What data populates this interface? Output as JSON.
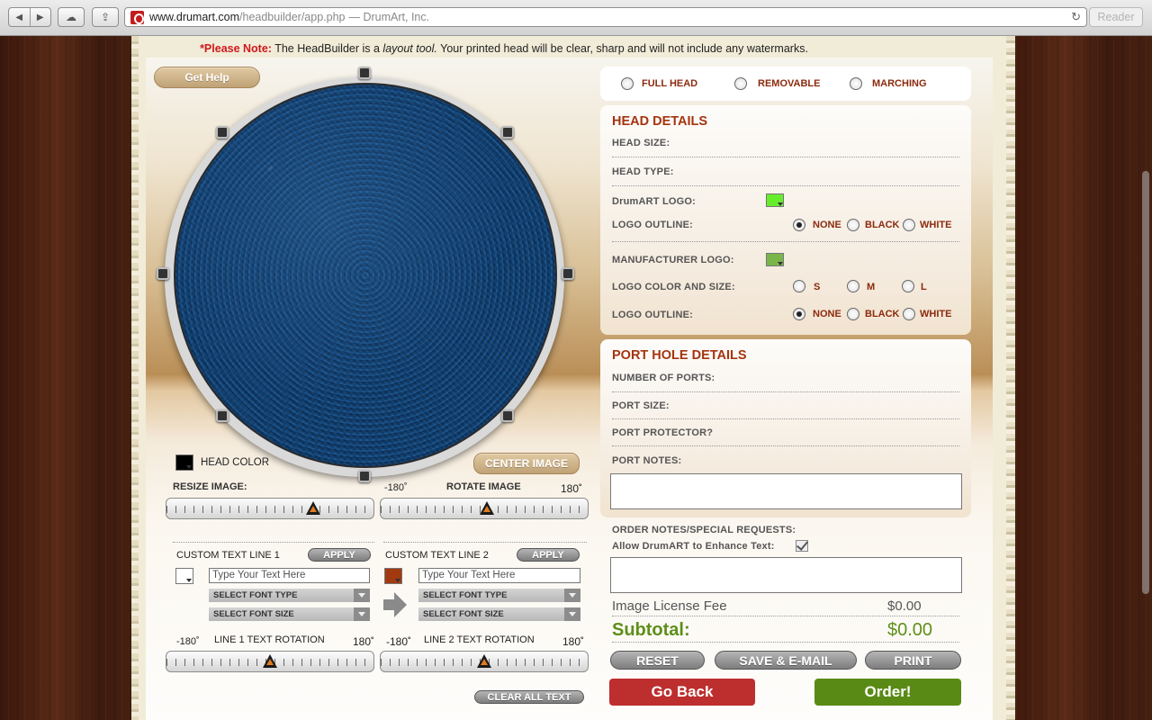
{
  "browser": {
    "url_host": "www.drumart.com",
    "url_path": "/headbuilder/app.php",
    "page_title": "— DrumArt, Inc.",
    "reader_label": "Reader"
  },
  "note": {
    "prefix": "*Please Note:",
    "text_a": " The HeadBuilder is a ",
    "text_em": "layout tool.",
    "text_b": " Your printed head will be clear, sharp and will not include any watermarks."
  },
  "left": {
    "get_help": "Get Help",
    "head_color_label": "HEAD COLOR",
    "center_image": "CENTER IMAGE",
    "resize_label": "RESIZE IMAGE:",
    "rotate_min": "-180˚",
    "rotate_label": "ROTATE IMAGE",
    "rotate_max": "180˚",
    "custom1_label": "CUSTOM TEXT LINE 1",
    "custom2_label": "CUSTOM TEXT LINE 2",
    "apply": "APPLY",
    "text_placeholder": "Type Your Text Here",
    "font_type": "SELECT FONT TYPE",
    "font_size": "SELECT FONT SIZE",
    "line1_rotation": "LINE 1 TEXT ROTATION",
    "line2_rotation": "LINE 2 TEXT ROTATION",
    "clear_all": "CLEAR ALL TEXT",
    "head_color_hex": "#000000",
    "text1_color_hex": "#ffffff",
    "text2_color_hex": "#a23a10"
  },
  "head_type_options": [
    "FULL HEAD",
    "REMOVABLE",
    "MARCHING"
  ],
  "head_details": {
    "title": "HEAD DETAILS",
    "head_size": "HEAD SIZE:",
    "head_type": "HEAD TYPE:",
    "drumart_logo": "DrumART LOGO:",
    "logo_outline": "LOGO OUTLINE:",
    "manufacturer_logo": "MANUFACTURER LOGO:",
    "logo_color_size": "LOGO COLOR AND SIZE:",
    "outline_options": [
      "NONE",
      "BLACK",
      "WHITE"
    ],
    "size_options": [
      "S",
      "M",
      "L"
    ],
    "drumart_logo_color": "#66ee2c",
    "manufacturer_logo_color": "#7ab54a"
  },
  "port_details": {
    "title": "PORT HOLE DETAILS",
    "number_of_ports": "NUMBER OF PORTS:",
    "port_size": "PORT SIZE:",
    "port_protector": "PORT PROTECTOR?",
    "port_notes": "PORT NOTES:"
  },
  "order": {
    "notes_label": "ORDER NOTES/SPECIAL REQUESTS:",
    "enhance_label": "Allow DrumART to Enhance Text:",
    "license_label": "Image License Fee",
    "license_value": "$0.00",
    "subtotal_label": "Subtotal:",
    "subtotal_value": "$0.00",
    "reset": "RESET",
    "save_email": "SAVE & E-MAIL",
    "print": "PRINT",
    "go_back": "Go Back",
    "order_now": "Order!"
  }
}
